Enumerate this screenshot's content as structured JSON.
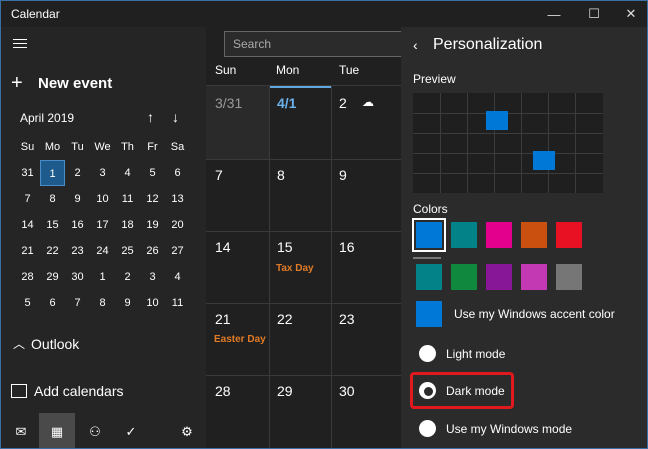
{
  "window": {
    "title": "Calendar",
    "controls": {
      "minimize": "—",
      "maximize": "☐",
      "close": "✕"
    }
  },
  "left": {
    "new_event_label": "New event",
    "mini_calendar": {
      "month_label": "April 2019",
      "weekday_heads": [
        "Su",
        "Mo",
        "Tu",
        "We",
        "Th",
        "Fr",
        "Sa"
      ],
      "weeks": [
        [
          "31",
          "1",
          "2",
          "3",
          "4",
          "5",
          "6"
        ],
        [
          "7",
          "8",
          "9",
          "10",
          "11",
          "12",
          "13"
        ],
        [
          "14",
          "15",
          "16",
          "17",
          "18",
          "19",
          "20"
        ],
        [
          "21",
          "22",
          "23",
          "24",
          "25",
          "26",
          "27"
        ],
        [
          "28",
          "29",
          "30",
          "1",
          "2",
          "3",
          "4"
        ],
        [
          "5",
          "6",
          "7",
          "8",
          "9",
          "10",
          "11"
        ]
      ],
      "selected_day": "1"
    },
    "outlook_label": "Outlook",
    "add_calendars_label": "Add calendars"
  },
  "main": {
    "search_placeholder": "Search",
    "day_headers": [
      "Sun",
      "Mon",
      "Tue"
    ],
    "rows": [
      [
        "3/31",
        "4/1",
        "2"
      ],
      [
        "7",
        "8",
        "9"
      ],
      [
        "14",
        "15",
        "16"
      ],
      [
        "21",
        "22",
        "23"
      ],
      [
        "28",
        "29",
        "30"
      ]
    ],
    "events": {
      "tax_day": "Tax Day",
      "easter_day": "Easter Day"
    }
  },
  "panel": {
    "title": "Personalization",
    "preview_label": "Preview",
    "colors_label": "Colors",
    "color_swatches_row1": [
      "#0078d7",
      "#038387",
      "#e3008c",
      "#ca5010",
      "#e81123"
    ],
    "color_swatches_row2": [
      "#038387",
      "#10893e",
      "#881798",
      "#c239b3",
      "#767676"
    ],
    "accent_label": "Use my Windows accent color",
    "modes": {
      "light": "Light mode",
      "dark": "Dark mode",
      "windows": "Use my Windows mode"
    },
    "selected_mode": "dark"
  }
}
